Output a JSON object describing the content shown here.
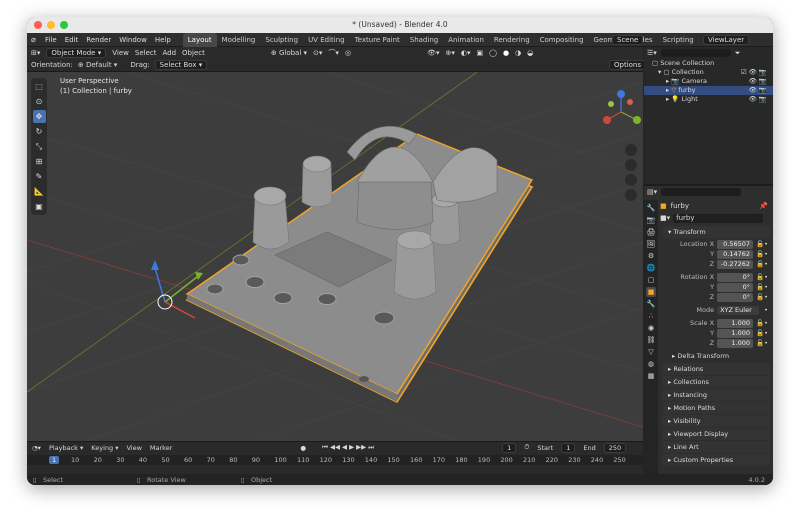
{
  "window": {
    "title": "* (Unsaved) - Blender 4.0"
  },
  "menu": [
    "File",
    "Edit",
    "Render",
    "Window",
    "Help"
  ],
  "workspace_tabs": [
    "Layout",
    "Modelling",
    "Sculpting",
    "UV Editing",
    "Texture Paint",
    "Shading",
    "Animation",
    "Rendering",
    "Compositing",
    "Geometry Nodes",
    "Scripting"
  ],
  "active_tab": "Layout",
  "scene": "Scene",
  "view_layer": "ViewLayer",
  "header": {
    "mode": "Object Mode",
    "view": "View",
    "select": "Select",
    "add": "Add",
    "object": "Object",
    "transform": "Global"
  },
  "header2": {
    "orientation_label": "Orientation:",
    "orientation": "Default",
    "drag_label": "Drag:",
    "drag": "Select Box",
    "options": "Options"
  },
  "viewport": {
    "perspective": "User Perspective",
    "collection": "(1) Collection | furby"
  },
  "outliner": {
    "root": "Scene Collection",
    "collection": "Collection",
    "items": [
      "Camera",
      "furby",
      "Light"
    ]
  },
  "properties": {
    "object_name": "furby",
    "mesh_name": "furby",
    "transform_title": "Transform",
    "location": {
      "label": "Location X",
      "x": "0.56507 m",
      "y": "0.14762 m",
      "z": "-0.27262"
    },
    "rotation": {
      "label": "Rotation X",
      "x": "0°",
      "y": "0°",
      "z": "0°"
    },
    "mode_label": "Mode",
    "mode": "XYZ Euler",
    "scale": {
      "label": "Scale X",
      "x": "1.000",
      "y": "1.000",
      "z": "1.000"
    },
    "axis": {
      "y": "Y",
      "z": "Z"
    },
    "sections": [
      "Delta Transform",
      "Relations",
      "Collections",
      "Instancing",
      "Motion Paths",
      "Visibility",
      "Viewport Display",
      "Line Art",
      "Custom Properties"
    ]
  },
  "timeline": {
    "playback": "Playback",
    "keying": "Keying",
    "view": "View",
    "marker": "Marker",
    "current": "1",
    "start_label": "Start",
    "start": "1",
    "end_label": "End",
    "end": "250",
    "ticks": [
      "1",
      "10",
      "20",
      "30",
      "40",
      "50",
      "60",
      "70",
      "80",
      "90",
      "100",
      "110",
      "120",
      "130",
      "140",
      "150",
      "160",
      "170",
      "180",
      "190",
      "200",
      "210",
      "220",
      "230",
      "240",
      "250"
    ]
  },
  "status": {
    "select": "Select",
    "rotate": "Rotate View",
    "object": "Object",
    "version": "4.0.2"
  },
  "colors": {
    "accent": "#4772b3",
    "selection": "#f5a623",
    "grid_x": "#9c3a3a",
    "grid_y": "#6b8e2f"
  }
}
